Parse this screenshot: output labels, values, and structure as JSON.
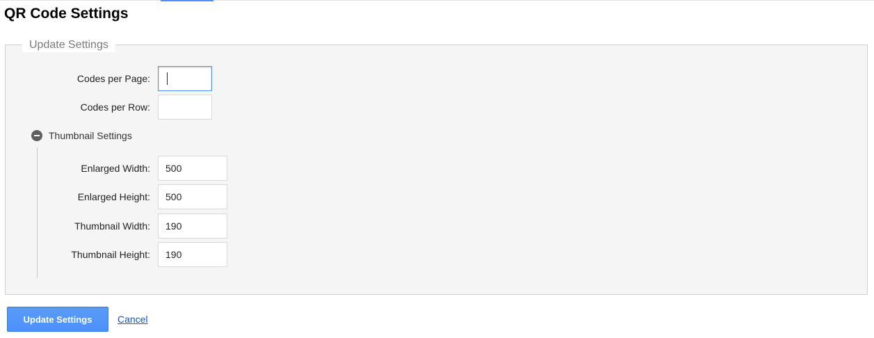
{
  "page": {
    "title": "QR Code Settings"
  },
  "update_settings": {
    "legend": "Update Settings",
    "codes_per_page": {
      "label": "Codes per Page:",
      "value": ""
    },
    "codes_per_row": {
      "label": "Codes per Row:",
      "value": ""
    }
  },
  "thumbnail_settings": {
    "toggle_label": "Thumbnail Settings",
    "toggle_icon": "collapse-minus-icon",
    "enlarged_width": {
      "label": "Enlarged Width:",
      "value": "500"
    },
    "enlarged_height": {
      "label": "Enlarged Height:",
      "value": "500"
    },
    "thumbnail_width": {
      "label": "Thumbnail Width:",
      "value": "190"
    },
    "thumbnail_height": {
      "label": "Thumbnail Height:",
      "value": "190"
    }
  },
  "actions": {
    "submit_label": "Update Settings",
    "cancel_label": "Cancel"
  },
  "colors": {
    "accent": "#4d90fe",
    "link": "#1155cc",
    "panel_background": "#f5f5f5"
  }
}
